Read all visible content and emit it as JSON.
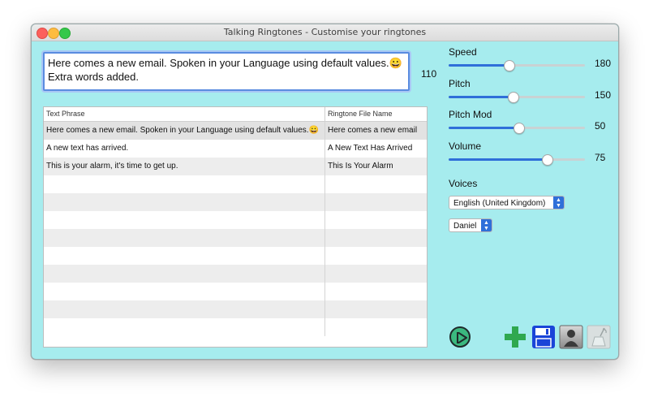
{
  "window": {
    "title": "Talking Ringtones - Customise your ringtones"
  },
  "editor": {
    "phrase": "Here comes a new email. Spoken in your Language using default values.😀 Extra words added.",
    "char_count": "110"
  },
  "table": {
    "columns": [
      "Text Phrase",
      "Ringtone File Name"
    ],
    "rows": [
      {
        "phrase": "Here comes a new email. Spoken in your Language using default values.😀",
        "file": "Here comes a new email"
      },
      {
        "phrase": "A new text has arrived.",
        "file": "A New Text Has Arrived"
      },
      {
        "phrase": "This is your alarm, it's time to get up.",
        "file": "This Is Your Alarm"
      }
    ],
    "empty_rows": 9
  },
  "sliders": [
    {
      "label": "Speed",
      "value": "180",
      "fraction": 0.44
    },
    {
      "label": "Pitch",
      "value": "150",
      "fraction": 0.47
    },
    {
      "label": "Pitch Mod",
      "value": "50",
      "fraction": 0.51
    },
    {
      "label": "Volume",
      "value": "75",
      "fraction": 0.72
    }
  ],
  "voices": {
    "label": "Voices",
    "language": "English (United Kingdom)",
    "voice": "Daniel"
  },
  "toolbar": {
    "play_icon": "play-icon",
    "add_icon": "plus-icon",
    "save_icon": "floppy-disk-icon",
    "contact_icon": "contact-person-icon",
    "assign_icon": "phone-ringtone-icon"
  },
  "colors": {
    "window_bg": "#a6ecee",
    "accent": "#2f6fd9",
    "play": "#3bb87f",
    "add": "#2fa84f",
    "save": "#1a45d8"
  }
}
